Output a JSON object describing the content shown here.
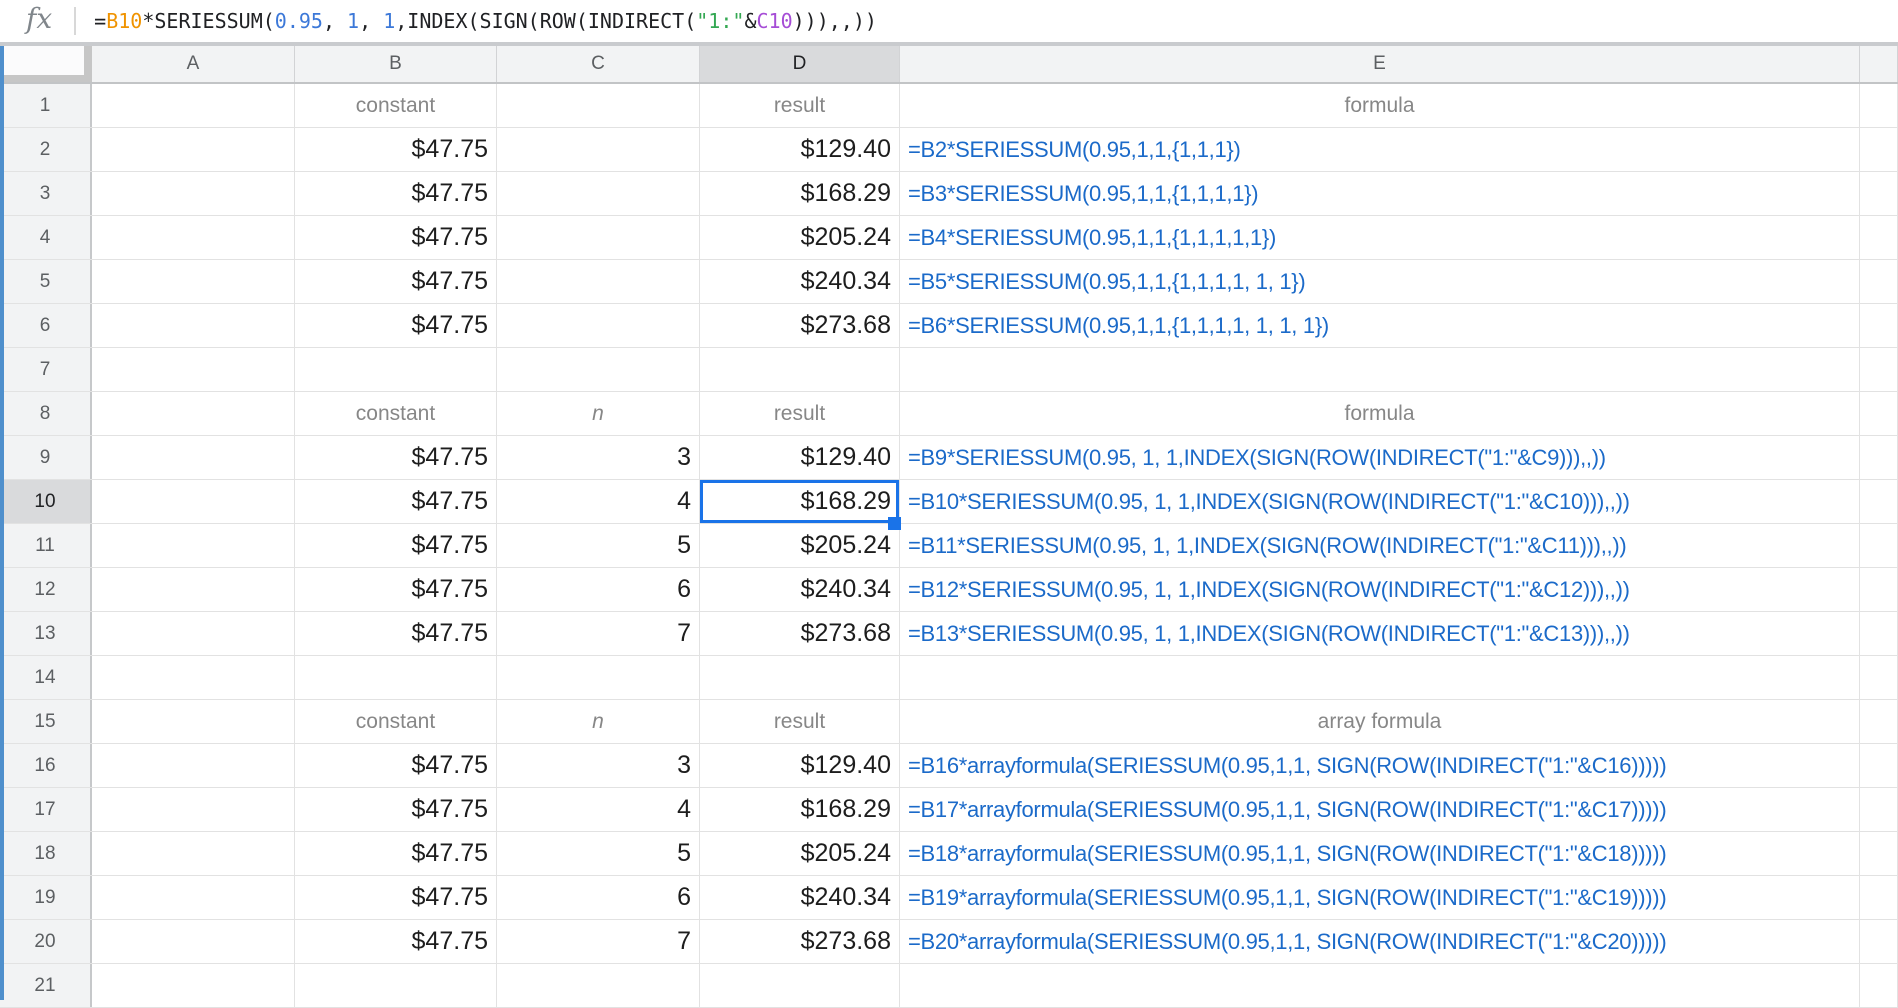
{
  "colors": {
    "sel": "#1a73e8",
    "formulatext": "#1b6ac9",
    "celltext": "#1d1d1d",
    "labeltext": "#878787",
    "hdrtext": "#5c5f62",
    "hdrbg": "#f2f3f4",
    "hdrhl": "#d9dadc",
    "gridline": "#e2e2e2",
    "strip": "#4f8fcc",
    "token_default": "#202124",
    "token_range": "#f09300",
    "token_number": "#3c78d8",
    "token_string": "#34a853",
    "token_range2": "#a64dd6"
  },
  "formula_bar": {
    "fx_label": "fx",
    "full_formula": "=B10*SERIESSUM(0.95, 1, 1,INDEX(SIGN(ROW(INDIRECT(\"1:\"&C10))),,))",
    "tokens": [
      {
        "text": "=",
        "color": "#202124"
      },
      {
        "text": "B10",
        "color": "#f09300"
      },
      {
        "text": "*SERIESSUM(",
        "color": "#202124"
      },
      {
        "text": "0.95",
        "color": "#3c78d8"
      },
      {
        "text": ", ",
        "color": "#202124"
      },
      {
        "text": "1",
        "color": "#3c78d8"
      },
      {
        "text": ", ",
        "color": "#202124"
      },
      {
        "text": "1",
        "color": "#3c78d8"
      },
      {
        "text": ",INDEX(SIGN(ROW(INDIRECT(",
        "color": "#202124"
      },
      {
        "text": "\"1:\"",
        "color": "#34a853"
      },
      {
        "text": "&",
        "color": "#202124"
      },
      {
        "text": "C10",
        "color": "#a64dd6"
      },
      {
        "text": "))),,))",
        "color": "#202124"
      }
    ]
  },
  "sheet": {
    "col_headers": [
      "A",
      "B",
      "C",
      "D",
      "E"
    ],
    "selection": {
      "col": "D",
      "row": "10"
    },
    "rows": [
      {
        "num": "1",
        "cells": {
          "B": {
            "text": "constant",
            "kind": "label"
          },
          "D": {
            "text": "result",
            "kind": "label"
          },
          "E": {
            "text": "formula",
            "kind": "label"
          }
        }
      },
      {
        "num": "2",
        "cells": {
          "B": {
            "text": "$47.75",
            "kind": "money"
          },
          "D": {
            "text": "$129.40",
            "kind": "money"
          },
          "E": {
            "text": "=B2*SERIESSUM(0.95,1,1,{1,1,1})",
            "kind": "formula"
          }
        }
      },
      {
        "num": "3",
        "cells": {
          "B": {
            "text": "$47.75",
            "kind": "money"
          },
          "D": {
            "text": "$168.29",
            "kind": "money"
          },
          "E": {
            "text": "=B3*SERIESSUM(0.95,1,1,{1,1,1,1})",
            "kind": "formula"
          }
        }
      },
      {
        "num": "4",
        "cells": {
          "B": {
            "text": "$47.75",
            "kind": "money"
          },
          "D": {
            "text": "$205.24",
            "kind": "money"
          },
          "E": {
            "text": "=B4*SERIESSUM(0.95,1,1,{1,1,1,1,1})",
            "kind": "formula"
          }
        }
      },
      {
        "num": "5",
        "cells": {
          "B": {
            "text": "$47.75",
            "kind": "money"
          },
          "D": {
            "text": "$240.34",
            "kind": "money"
          },
          "E": {
            "text": "=B5*SERIESSUM(0.95,1,1,{1,1,1,1, 1, 1})",
            "kind": "formula"
          }
        }
      },
      {
        "num": "6",
        "cells": {
          "B": {
            "text": "$47.75",
            "kind": "money"
          },
          "D": {
            "text": "$273.68",
            "kind": "money"
          },
          "E": {
            "text": "=B6*SERIESSUM(0.95,1,1,{1,1,1,1, 1, 1, 1})",
            "kind": "formula"
          }
        }
      },
      {
        "num": "7",
        "cells": {}
      },
      {
        "num": "8",
        "cells": {
          "B": {
            "text": "constant",
            "kind": "label"
          },
          "C": {
            "text": "n",
            "kind": "label_i"
          },
          "D": {
            "text": "result",
            "kind": "label"
          },
          "E": {
            "text": "formula",
            "kind": "label"
          }
        }
      },
      {
        "num": "9",
        "cells": {
          "B": {
            "text": "$47.75",
            "kind": "money"
          },
          "C": {
            "text": "3",
            "kind": "num"
          },
          "D": {
            "text": "$129.40",
            "kind": "money"
          },
          "E": {
            "text": "=B9*SERIESSUM(0.95, 1, 1,INDEX(SIGN(ROW(INDIRECT(\"1:\"&C9))),,))",
            "kind": "formula"
          }
        }
      },
      {
        "num": "10",
        "cells": {
          "B": {
            "text": "$47.75",
            "kind": "money"
          },
          "C": {
            "text": "4",
            "kind": "num"
          },
          "D": {
            "text": "$168.29",
            "kind": "money"
          },
          "E": {
            "text": "=B10*SERIESSUM(0.95, 1, 1,INDEX(SIGN(ROW(INDIRECT(\"1:\"&C10))),,))",
            "kind": "formula"
          }
        }
      },
      {
        "num": "11",
        "cells": {
          "B": {
            "text": "$47.75",
            "kind": "money"
          },
          "C": {
            "text": "5",
            "kind": "num"
          },
          "D": {
            "text": "$205.24",
            "kind": "money"
          },
          "E": {
            "text": "=B11*SERIESSUM(0.95, 1, 1,INDEX(SIGN(ROW(INDIRECT(\"1:\"&C11))),,))",
            "kind": "formula"
          }
        }
      },
      {
        "num": "12",
        "cells": {
          "B": {
            "text": "$47.75",
            "kind": "money"
          },
          "C": {
            "text": "6",
            "kind": "num"
          },
          "D": {
            "text": "$240.34",
            "kind": "money"
          },
          "E": {
            "text": "=B12*SERIESSUM(0.95, 1, 1,INDEX(SIGN(ROW(INDIRECT(\"1:\"&C12))),,))",
            "kind": "formula"
          }
        }
      },
      {
        "num": "13",
        "cells": {
          "B": {
            "text": "$47.75",
            "kind": "money"
          },
          "C": {
            "text": "7",
            "kind": "num"
          },
          "D": {
            "text": "$273.68",
            "kind": "money"
          },
          "E": {
            "text": "=B13*SERIESSUM(0.95, 1, 1,INDEX(SIGN(ROW(INDIRECT(\"1:\"&C13))),,))",
            "kind": "formula"
          }
        }
      },
      {
        "num": "14",
        "cells": {}
      },
      {
        "num": "15",
        "cells": {
          "B": {
            "text": "constant",
            "kind": "label"
          },
          "C": {
            "text": "n",
            "kind": "label_i"
          },
          "D": {
            "text": "result",
            "kind": "label"
          },
          "E": {
            "text": "array formula",
            "kind": "label"
          }
        }
      },
      {
        "num": "16",
        "cells": {
          "B": {
            "text": "$47.75",
            "kind": "money"
          },
          "C": {
            "text": "3",
            "kind": "num"
          },
          "D": {
            "text": "$129.40",
            "kind": "money"
          },
          "E": {
            "text": "=B16*arrayformula(SERIESSUM(0.95,1,1, SIGN(ROW(INDIRECT(\"1:\"&C16)))))",
            "kind": "formula"
          }
        }
      },
      {
        "num": "17",
        "cells": {
          "B": {
            "text": "$47.75",
            "kind": "money"
          },
          "C": {
            "text": "4",
            "kind": "num"
          },
          "D": {
            "text": "$168.29",
            "kind": "money"
          },
          "E": {
            "text": "=B17*arrayformula(SERIESSUM(0.95,1,1, SIGN(ROW(INDIRECT(\"1:\"&C17)))))",
            "kind": "formula"
          }
        }
      },
      {
        "num": "18",
        "cells": {
          "B": {
            "text": "$47.75",
            "kind": "money"
          },
          "C": {
            "text": "5",
            "kind": "num"
          },
          "D": {
            "text": "$205.24",
            "kind": "money"
          },
          "E": {
            "text": "=B18*arrayformula(SERIESSUM(0.95,1,1, SIGN(ROW(INDIRECT(\"1:\"&C18)))))",
            "kind": "formula"
          }
        }
      },
      {
        "num": "19",
        "cells": {
          "B": {
            "text": "$47.75",
            "kind": "money"
          },
          "C": {
            "text": "6",
            "kind": "num"
          },
          "D": {
            "text": "$240.34",
            "kind": "money"
          },
          "E": {
            "text": "=B19*arrayformula(SERIESSUM(0.95,1,1, SIGN(ROW(INDIRECT(\"1:\"&C19)))))",
            "kind": "formula"
          }
        }
      },
      {
        "num": "20",
        "cells": {
          "B": {
            "text": "$47.75",
            "kind": "money"
          },
          "C": {
            "text": "7",
            "kind": "num"
          },
          "D": {
            "text": "$273.68",
            "kind": "money"
          },
          "E": {
            "text": "=B20*arrayformula(SERIESSUM(0.95,1,1, SIGN(ROW(INDIRECT(\"1:\"&C20)))))",
            "kind": "formula"
          }
        }
      },
      {
        "num": "21",
        "cells": {}
      }
    ]
  }
}
